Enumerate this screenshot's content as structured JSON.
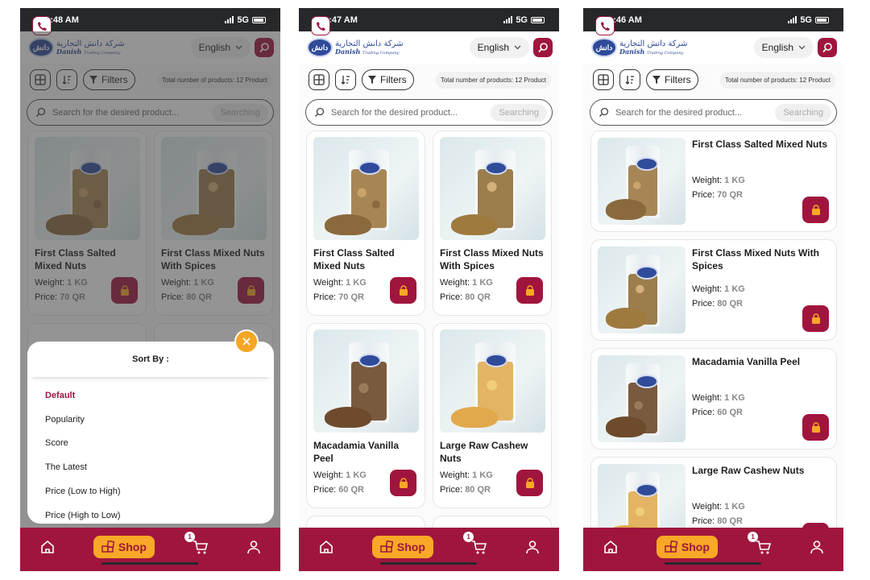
{
  "brand": {
    "arabic": "شركة دانش التجارية",
    "english": "Danish",
    "sub": "Trading Company",
    "mark": "دانش"
  },
  "colors": {
    "primary": "#a0153e",
    "accent": "#f8a826",
    "statusbar": "#26282b"
  },
  "header": {
    "language": "English",
    "search_icon": "search-icon",
    "phone_icon": "phone-icon"
  },
  "toolbar": {
    "filters_label": "Filters",
    "total_label": "Total number of products: 12 Product"
  },
  "search": {
    "placeholder": "Search for the desired product...",
    "button_label": "Searching"
  },
  "labels": {
    "weight": "Weight:",
    "price": "Price:"
  },
  "screens": [
    {
      "time": "10:48 AM",
      "network": "5G"
    },
    {
      "time": "10:47 AM",
      "network": "5G"
    },
    {
      "time": "10:46 AM",
      "network": "5G"
    }
  ],
  "products": [
    {
      "name": "First Class Salted Mixed Nuts",
      "weight": "1 KG",
      "price": "70 QR"
    },
    {
      "name": "First Class Mixed Nuts With Spices",
      "weight": "1 KG",
      "price": "80 QR"
    },
    {
      "name": "Macadamia Vanilla Peel",
      "weight": "1 KG",
      "price": "60 QR"
    },
    {
      "name": "Large Raw Cashew Nuts",
      "weight": "1 KG",
      "price": "80 QR"
    }
  ],
  "sort_sheet": {
    "title": "Sort By :",
    "options": [
      "Default",
      "Popularity",
      "Score",
      "The Latest",
      "Price (Low to High)",
      "Price (High to Low)"
    ],
    "selected": "Default",
    "close_icon": "close-icon"
  },
  "nav": {
    "shop_label": "Shop",
    "cart_count": "1",
    "icons": [
      "home-icon",
      "shop-icon",
      "cart-icon",
      "profile-icon"
    ]
  }
}
